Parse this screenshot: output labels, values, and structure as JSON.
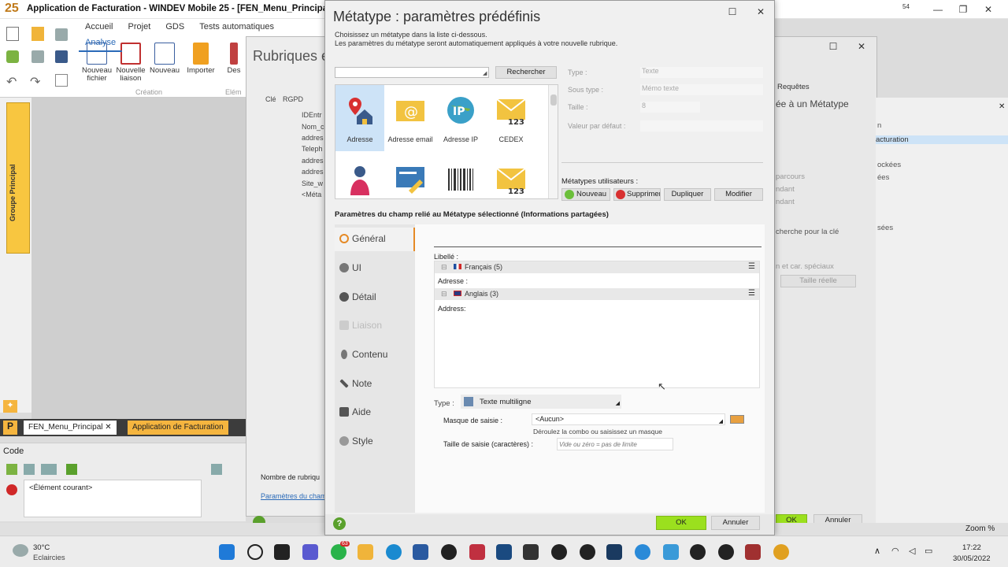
{
  "app": {
    "title": "Application de Facturation - WINDEV Mobile 25 - [FEN_Menu_Principal]",
    "logo": "25",
    "page_badge": "54"
  },
  "menu": [
    "Accueil",
    "Projet",
    "GDS",
    "Tests automatiques",
    "Analyse"
  ],
  "ribbon": {
    "buttons": [
      "Nouveau fichier",
      "Nouvelle liaison",
      "Nouveau",
      "Importer",
      "Des"
    ],
    "group_label": "Création",
    "group_label_2": "Elém"
  },
  "left": {
    "groupe_label": "Groupe Principal"
  },
  "rubriques": {
    "title": "Rubriques e",
    "col_cle": "Clé",
    "col_rgpd": "RGPD",
    "rows": [
      "IDEntr",
      "Nom_c",
      "addres",
      "Teleph",
      "addres",
      "addres",
      "Site_w",
      "<Méta"
    ],
    "footer": "Nombre de rubriqu",
    "link": "Paramètres du cham"
  },
  "rightwin": {
    "tab": "Requêtes",
    "heading": "ée à un Métatype",
    "line1": "parcours",
    "line2": "ndant",
    "line3": "ndant",
    "line4": "cherche pour la clé",
    "line5": "n et car. spéciaux",
    "btn_taille": "Taille réelle",
    "ok": "OK",
    "annuler": "Annuler"
  },
  "rightpanel": {
    "item1": "n",
    "item2": "acturation",
    "item3": "ockées",
    "item4": "ées",
    "item5": "sées",
    "zoom": "Zoom %"
  },
  "tabs": {
    "tab1": "FEN_Menu_Principal",
    "tab2": "Application de Facturation"
  },
  "code": {
    "title": "Code",
    "current": "<Élément courant>"
  },
  "dialog": {
    "title": "Métatype : paramètres prédéfinis",
    "subtitle1": "Choisissez un métatype dans la liste ci-dessous.",
    "subtitle2": "Les paramètres du métatype seront automatiquement appliqués à votre nouvelle rubrique.",
    "search_value": "",
    "search_button": "Rechercher",
    "gallery": [
      {
        "label": "Adresse",
        "icon": "map-pin-house-icon",
        "selected": true
      },
      {
        "label": "Adresse email",
        "icon": "envelope-at-icon",
        "selected": false
      },
      {
        "label": "Adresse IP",
        "icon": "globe-ip-icon",
        "selected": false
      },
      {
        "label": "CEDEX",
        "icon": "envelope-123-icon",
        "selected": false
      },
      {
        "label": "",
        "icon": "person-icon",
        "selected": false
      },
      {
        "label": "",
        "icon": "card-pen-icon",
        "selected": false
      },
      {
        "label": "",
        "icon": "barcode-icon",
        "selected": false
      },
      {
        "label": "",
        "icon": "envelope-123-icon",
        "selected": false
      }
    ],
    "props": {
      "type_label": "Type :",
      "type_value": "Texte",
      "soustype_label": "Sous type :",
      "soustype_value": "Mémo texte",
      "taille_label": "Taille :",
      "taille_value": "8",
      "defaut_label": "Valeur par défaut :",
      "defaut_value": ""
    },
    "user_metatypes_label": "Métatypes utilisateurs :",
    "user_buttons": {
      "nouveau": "Nouveau",
      "supprimer": "Supprimer",
      "dupliquer": "Dupliquer",
      "modifier": "Modifier"
    },
    "section_title": "Paramètres du champ relié au Métatype sélectionné (Informations partagées)",
    "nav": [
      {
        "label": "Général",
        "icon": "circle-icon",
        "active": true,
        "disabled": false
      },
      {
        "label": "UI",
        "icon": "eye-icon",
        "active": false,
        "disabled": false
      },
      {
        "label": "Détail",
        "icon": "chevron-circle-icon",
        "active": false,
        "disabled": false
      },
      {
        "label": "Liaison",
        "icon": "link-icon",
        "active": false,
        "disabled": true
      },
      {
        "label": "Contenu",
        "icon": "flask-icon",
        "active": false,
        "disabled": false
      },
      {
        "label": "Note",
        "icon": "pencil-icon",
        "active": false,
        "disabled": false
      },
      {
        "label": "Aide",
        "icon": "help-icon",
        "active": false,
        "disabled": false
      },
      {
        "label": "Style",
        "icon": "palette-icon",
        "active": false,
        "disabled": false
      }
    ],
    "libelle_label": "Libellé :",
    "lang_fr": "Français (5)",
    "lang_fr_value": "Adresse :",
    "lang_en": "Anglais (3)",
    "lang_en_value": "Address:",
    "type_field_label": "Type :",
    "type_field_value": "Texte multiligne",
    "masque_label": "Masque de saisie :",
    "masque_value": "<Aucun>",
    "masque_hint": "Déroulez la combo ou saisissez un masque",
    "taille_saisie_label": "Taille de saisie (caractères) :",
    "taille_saisie_placeholder": "Vide ou zéro = pas de limite",
    "ok": "OK",
    "annuler": "Annuler"
  },
  "taskbar": {
    "weather_temp": "30°C",
    "weather_desc": "Eclaircies",
    "time": "17:22",
    "date": "30/05/2022",
    "badge1": "63"
  },
  "colors": {
    "accent_orange": "#e58a26",
    "ok_green": "#9be01e",
    "link_blue": "#2a6ab8"
  }
}
